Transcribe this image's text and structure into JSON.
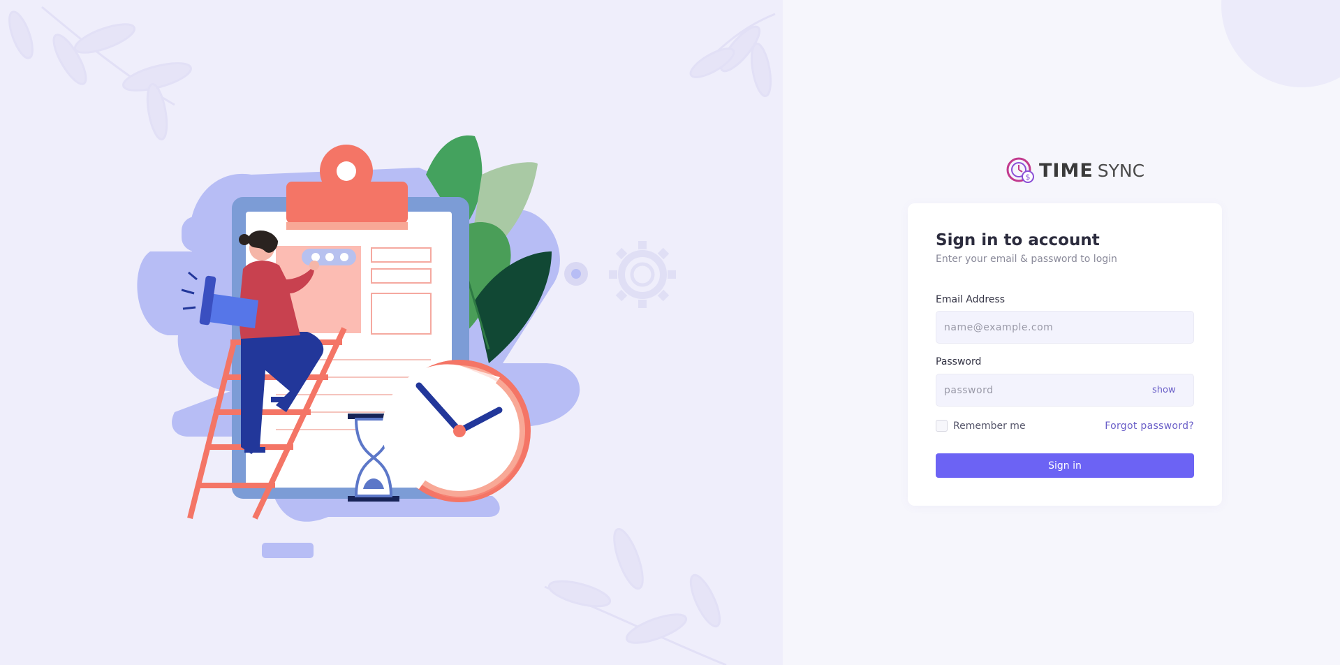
{
  "brand": {
    "name_bold": "TIME",
    "name_light": "SYNC"
  },
  "login": {
    "title": "Sign in to account",
    "subtitle": "Enter your email & password to login",
    "email_label": "Email Address",
    "email_placeholder": "name@example.com",
    "email_value": "",
    "password_label": "Password",
    "password_placeholder": "password",
    "password_value": "",
    "show_label": "show",
    "remember_label": "Remember me",
    "remember_checked": false,
    "forgot_label": "Forgot password?",
    "signin_label": "Sign in"
  },
  "colors": {
    "accent": "#6c63f4",
    "link": "#6a5fc8",
    "left_bg": "#efeefb",
    "right_bg": "#f6f6fc"
  },
  "icons": {
    "logo": "clock-dollar-icon",
    "illustration": "person-on-ladder-with-clipboard-and-clock"
  }
}
